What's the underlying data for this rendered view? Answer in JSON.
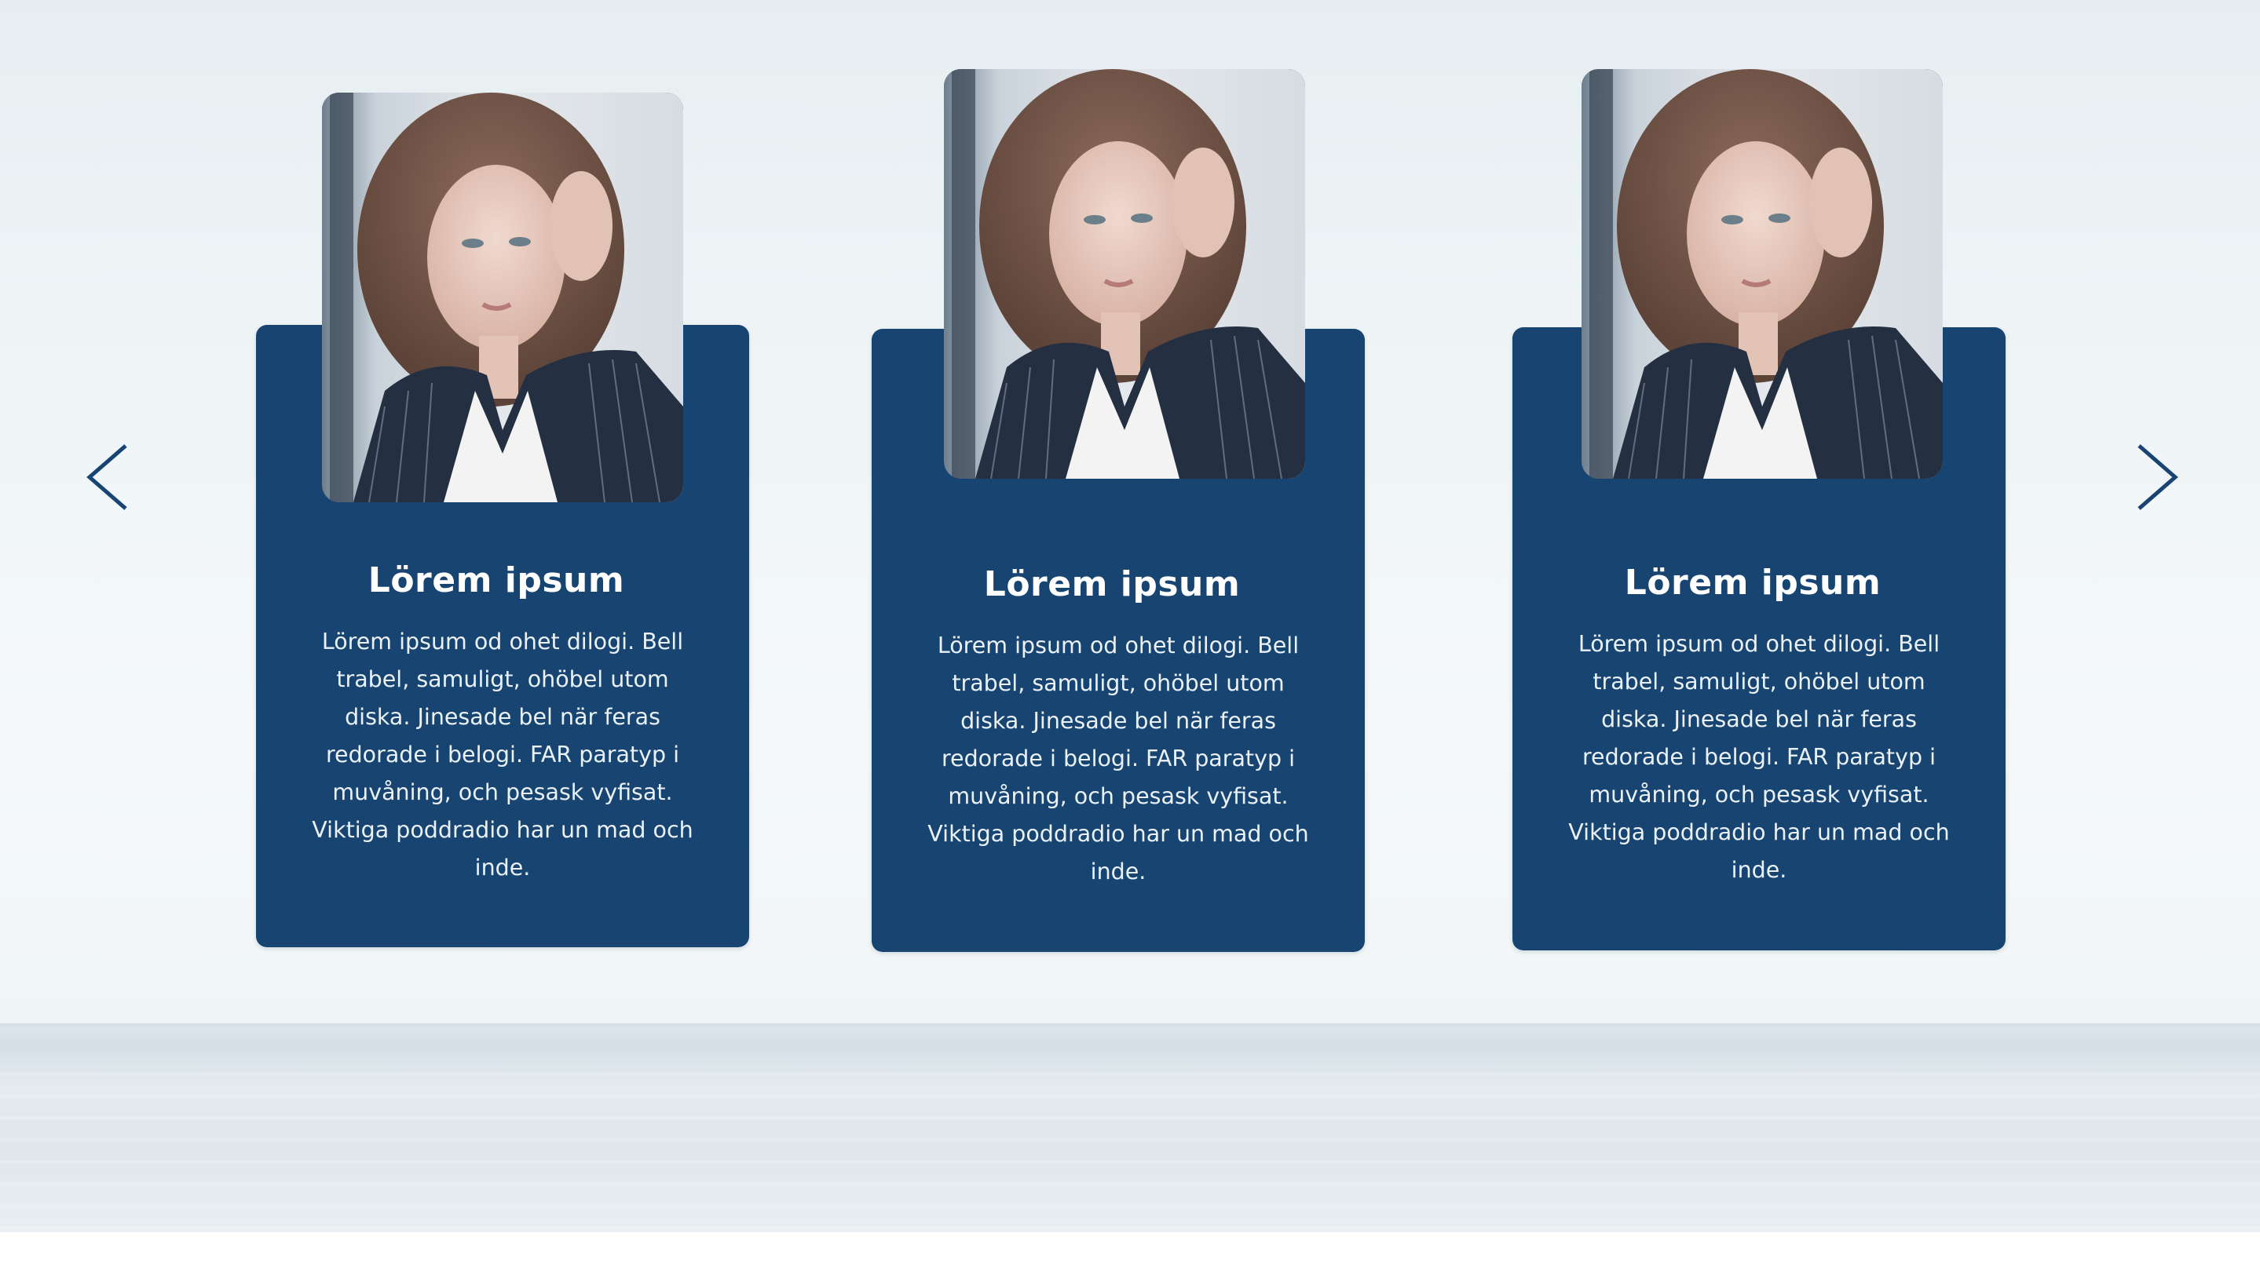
{
  "carousel": {
    "prev_icon": "chevron-left-icon",
    "next_icon": "chevron-right-icon",
    "accent_color": "#174470",
    "arrow_color": "#174470",
    "cards": [
      {
        "title": "Lörem ipsum",
        "text": "Lörem ipsum od ohet dilogi. Bell trabel, samuligt, ohöbel utom diska. Jinesade bel när feras redorade i belogi. FAR paratyp i muvåning, och pesask vyfisat. Viktiga poddradio har un mad och inde."
      },
      {
        "title": "Lörem ipsum",
        "text": "Lörem ipsum od ohet dilogi. Bell trabel, samuligt, ohöbel utom diska. Jinesade bel när feras redorade i belogi. FAR paratyp i muvåning, och pesask vyfisat. Viktiga poddradio har un mad och inde."
      },
      {
        "title": "Lörem ipsum",
        "text": "Lörem ipsum od ohet dilogi. Bell trabel, samuligt, ohöbel utom diska. Jinesade bel när feras redorade i belogi. FAR paratyp i muvåning, och pesask vyfisat. Viktiga poddradio har un mad och inde."
      }
    ]
  }
}
